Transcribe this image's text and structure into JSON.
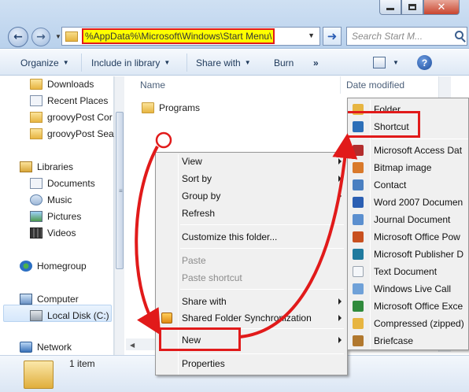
{
  "window": {
    "address_path": "%AppData%\\Microsoft\\Windows\\Start Menu\\",
    "search_placeholder": "Search Start M...",
    "controls": {
      "minimize": "minimize",
      "maximize": "maximize",
      "close": "✕"
    }
  },
  "toolbar": {
    "organize": "Organize",
    "include_in_library": "Include in library",
    "share_with": "Share with",
    "burn": "Burn",
    "more": "»",
    "help": "?"
  },
  "sidebar": {
    "favorites": [
      {
        "label": "Downloads",
        "icon": "folder-icon"
      },
      {
        "label": "Recent Places",
        "icon": "recent-places-icon"
      },
      {
        "label": "groovyPost Cor",
        "icon": "shortcut-folder-icon"
      },
      {
        "label": "groovyPost Sear",
        "icon": "shortcut-folder-icon"
      }
    ],
    "libraries": {
      "label": "Libraries",
      "items": [
        "Documents",
        "Music",
        "Pictures",
        "Videos"
      ]
    },
    "homegroup": "Homegroup",
    "computer": {
      "label": "Computer",
      "items": [
        "Local Disk (C:)"
      ]
    },
    "network": "Network"
  },
  "main": {
    "columns": {
      "name": "Name",
      "date_modified": "Date modified"
    },
    "items": [
      {
        "name": "Programs",
        "icon": "folder-icon"
      }
    ]
  },
  "status": {
    "count": "1 item"
  },
  "context_menu": {
    "items": [
      {
        "label": "View",
        "submenu": true,
        "enabled": true
      },
      {
        "label": "Sort by",
        "submenu": true,
        "enabled": true
      },
      {
        "label": "Group by",
        "submenu": true,
        "enabled": true
      },
      {
        "label": "Refresh",
        "submenu": false,
        "enabled": true
      },
      {
        "label": "Customize this folder...",
        "submenu": false,
        "enabled": true
      },
      {
        "label": "Paste",
        "submenu": false,
        "enabled": false
      },
      {
        "label": "Paste shortcut",
        "submenu": false,
        "enabled": false
      },
      {
        "label": "Share with",
        "submenu": true,
        "enabled": true
      },
      {
        "label": "Shared Folder Synchronization",
        "submenu": true,
        "enabled": true
      },
      {
        "label": "New",
        "submenu": true,
        "enabled": true
      },
      {
        "label": "Properties",
        "submenu": false,
        "enabled": true
      }
    ]
  },
  "new_submenu": {
    "items": [
      {
        "label": "Folder",
        "icon": "folder-icon",
        "color": "#e7b541"
      },
      {
        "label": "Shortcut",
        "icon": "shortcut-icon",
        "color": "#2d6fb8"
      },
      {
        "label": "Microsoft Access Dat",
        "icon": "access-icon",
        "color": "#b32d2d"
      },
      {
        "label": "Bitmap image",
        "icon": "bitmap-icon",
        "color": "#d9792a"
      },
      {
        "label": "Contact",
        "icon": "contact-icon",
        "color": "#4a7fc1"
      },
      {
        "label": "Word 2007 Documen",
        "icon": "word-icon",
        "color": "#2b5fb3"
      },
      {
        "label": "Journal Document",
        "icon": "journal-icon",
        "color": "#5b8fcf"
      },
      {
        "label": "Microsoft Office Pow",
        "icon": "powerpoint-icon",
        "color": "#c8501f"
      },
      {
        "label": "Microsoft Publisher D",
        "icon": "publisher-icon",
        "color": "#1f7a9e"
      },
      {
        "label": "Text Document",
        "icon": "text-doc-icon",
        "color": "#9aa4b0"
      },
      {
        "label": "Windows Live Call",
        "icon": "live-call-icon",
        "color": "#6fa1d8"
      },
      {
        "label": "Microsoft Office Exce",
        "icon": "excel-icon",
        "color": "#2f8a3c"
      },
      {
        "label": "Compressed (zipped)",
        "icon": "zip-folder-icon",
        "color": "#e7b541"
      },
      {
        "label": "Briefcase",
        "icon": "briefcase-icon",
        "color": "#b1782e"
      }
    ]
  },
  "annotations": {
    "highlight_color": "#e11a1a"
  }
}
